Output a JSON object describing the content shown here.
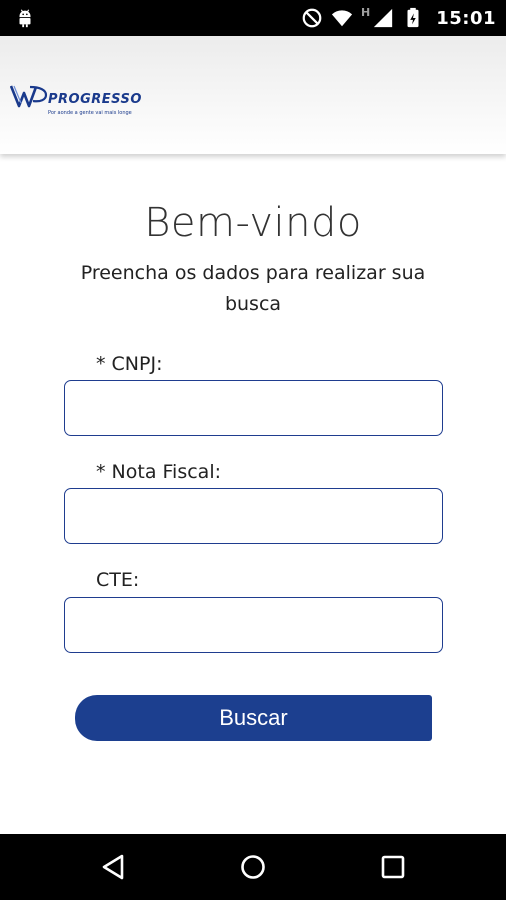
{
  "status_bar": {
    "time": "15:01",
    "network_badge": "H",
    "icons": [
      "android-icon",
      "do-not-disturb-icon",
      "wifi-icon",
      "cell-signal-icon",
      "battery-charging-icon"
    ]
  },
  "header": {
    "logo_name": "PROGRESSO",
    "logo_tagline": "Por aonde a gente vai mais longe"
  },
  "main": {
    "title": "Bem-vindo",
    "subtitle": "Preencha os dados para realizar sua busca",
    "fields": [
      {
        "label": "* CNPJ:",
        "value": "",
        "placeholder": ""
      },
      {
        "label": "* Nota Fiscal:",
        "value": "",
        "placeholder": ""
      },
      {
        "label": "CTE:",
        "value": "",
        "placeholder": ""
      }
    ],
    "search_button_label": "Buscar"
  },
  "nav_bar": {
    "icons": [
      "back-icon",
      "home-icon",
      "recents-icon"
    ]
  },
  "colors": {
    "accent": "#1c3f8f",
    "input_border": "#1f3d8f",
    "status_bar": "#000000"
  }
}
